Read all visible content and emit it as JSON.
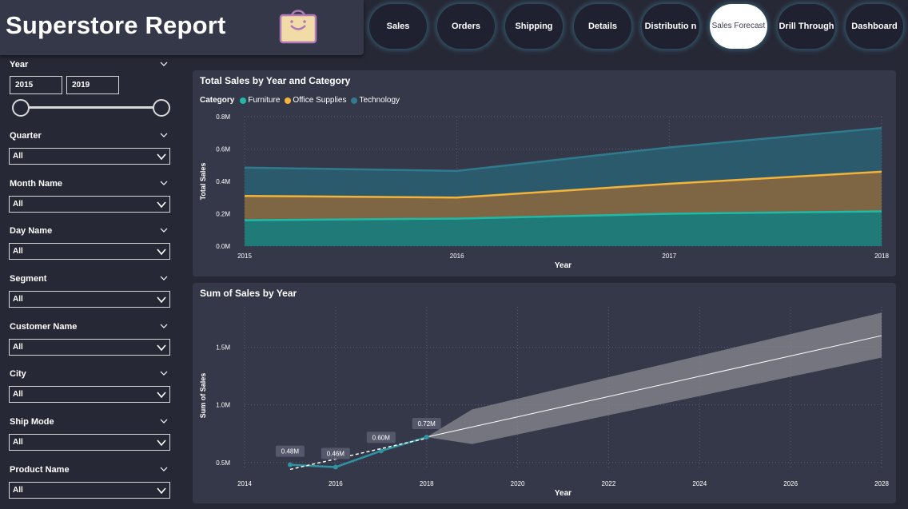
{
  "header": {
    "title": "Superstore Report",
    "icon": "shopping-bag-icon"
  },
  "nav": [
    {
      "label": "Sales",
      "active": false
    },
    {
      "label": "Orders",
      "active": false
    },
    {
      "label": "Shipping",
      "active": false
    },
    {
      "label": "Details",
      "active": false
    },
    {
      "label": "Distributio n",
      "active": false
    },
    {
      "label": "Sales Forecast",
      "active": true
    },
    {
      "label": "Drill Through",
      "active": false
    },
    {
      "label": "Dashboard",
      "active": false
    }
  ],
  "filters": {
    "year": {
      "label": "Year",
      "from": "2015",
      "to": "2019"
    },
    "dropdowns": [
      {
        "label": "Quarter",
        "value": "All"
      },
      {
        "label": "Month Name",
        "value": "All"
      },
      {
        "label": "Day Name",
        "value": "All"
      },
      {
        "label": "Segment",
        "value": "All"
      },
      {
        "label": "Customer Name",
        "value": "All"
      },
      {
        "label": "City",
        "value": "All"
      },
      {
        "label": "Ship Mode",
        "value": "All"
      },
      {
        "label": "Product Name",
        "value": "All"
      }
    ]
  },
  "colors": {
    "furniture": "#1fb9a6",
    "office_supplies": "#f2b43b",
    "technology": "#2f7a8c",
    "forecast_band": "#8a8a92",
    "actual_line": "#2e93a3",
    "accent": "#ffffff"
  },
  "chart_data": [
    {
      "type": "area",
      "title": "Total Sales by Year and Category",
      "legend_title": "Category",
      "legend_position": "top-left",
      "xlabel": "Year",
      "ylabel": "Total Sales",
      "categories": [
        "2015",
        "2016",
        "2017",
        "2018"
      ],
      "x": [
        2015,
        2016,
        2017,
        2018
      ],
      "x_ticks": [
        "2015",
        "2016",
        "2017",
        "2018"
      ],
      "ylim": [
        0,
        800000
      ],
      "y_ticks": [
        "0.0M",
        "0.2M",
        "0.4M",
        "0.6M",
        "0.8M"
      ],
      "stacked": true,
      "grid": true,
      "series": [
        {
          "name": "Furniture",
          "values": [
            160000,
            170000,
            200000,
            215000
          ]
        },
        {
          "name": "Office Supplies",
          "values": [
            150000,
            130000,
            185000,
            245000
          ]
        },
        {
          "name": "Technology",
          "values": [
            175000,
            165000,
            225000,
            270000
          ]
        }
      ]
    },
    {
      "type": "line",
      "title": "Sum of Sales by Year",
      "xlabel": "Year",
      "ylabel": "Sum of Sales",
      "xlim": [
        2014,
        2028
      ],
      "x_ticks": [
        "2014",
        "2016",
        "2018",
        "2020",
        "2022",
        "2024",
        "2026",
        "2028"
      ],
      "ylim": [
        0.45,
        1.85
      ],
      "y_ticks": [
        "0.5M",
        "1.0M",
        "1.5M"
      ],
      "grid": true,
      "series": [
        {
          "x": [
            2015,
            2016,
            2017,
            2018
          ],
          "values": [
            0.48,
            0.46,
            0.6,
            0.72
          ],
          "data_labels": [
            "0.48M",
            "0.46M",
            "0.60M",
            "0.72M"
          ]
        },
        {
          "style": "dashed-trend",
          "x": [
            2015,
            2018
          ],
          "values": [
            0.44,
            0.71
          ]
        },
        {
          "style": "forecast",
          "x": [
            2018,
            2028
          ],
          "values": [
            0.72,
            1.6
          ],
          "band_x": [
            2018,
            2019,
            2028
          ],
          "band_upper": [
            0.72,
            0.96,
            1.8
          ],
          "band_lower": [
            0.72,
            0.66,
            1.41
          ]
        }
      ]
    }
  ]
}
